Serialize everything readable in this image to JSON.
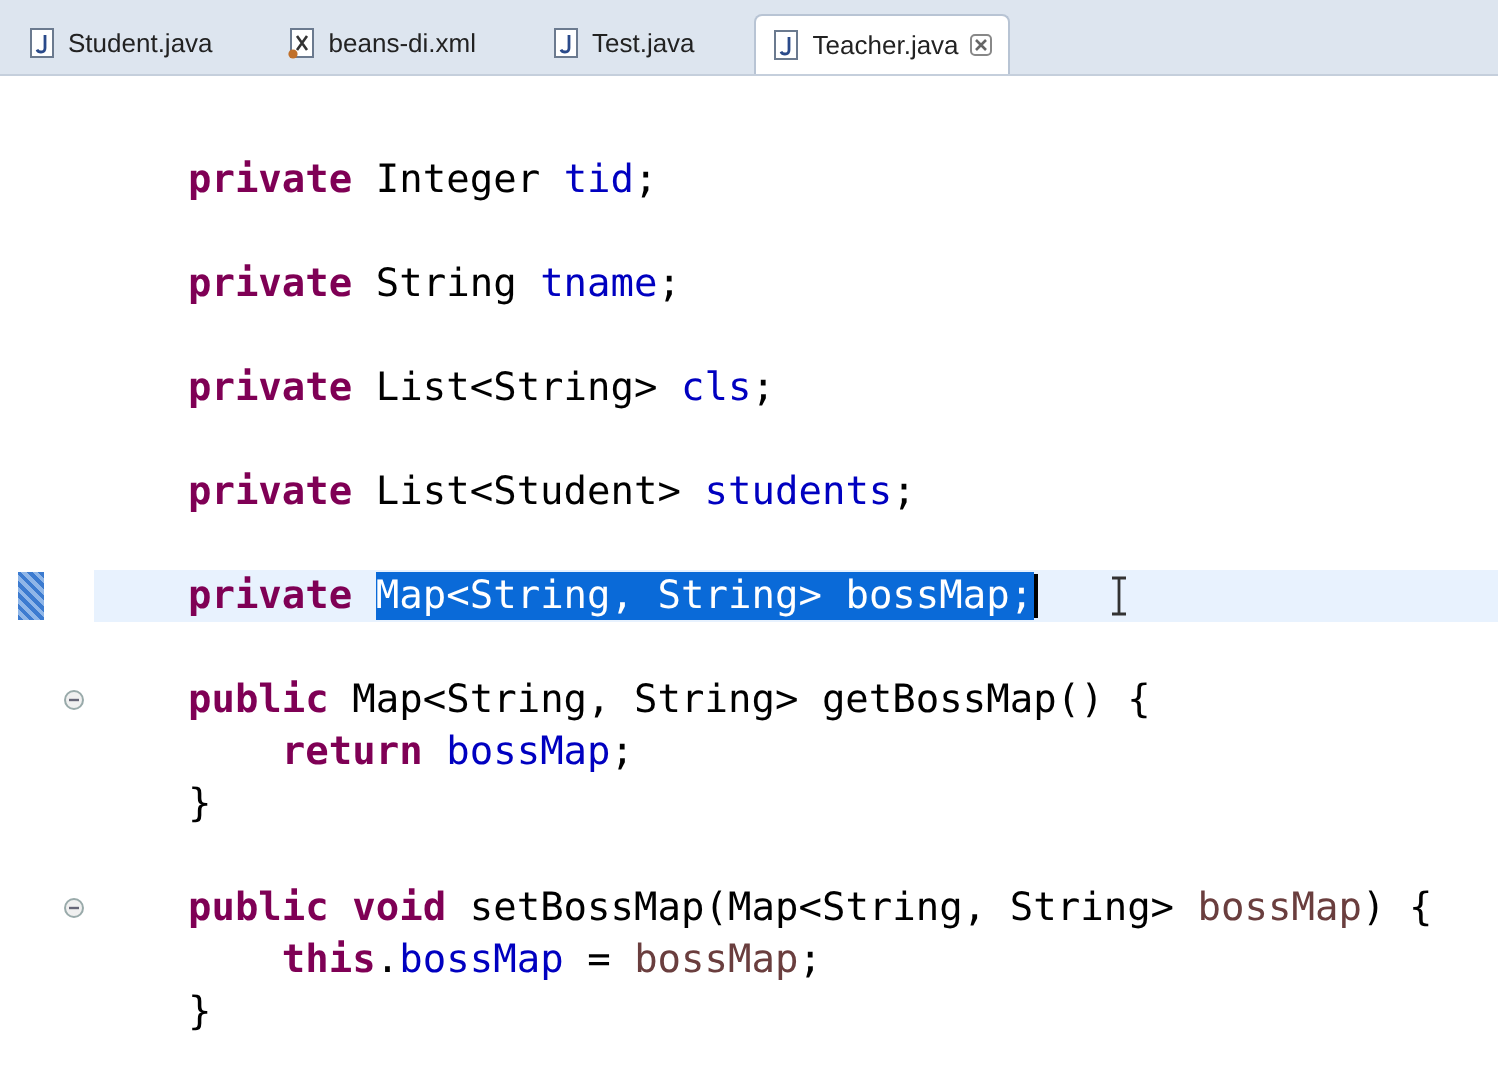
{
  "tabs": [
    {
      "label": "Student.java",
      "kind": "java",
      "selected": false
    },
    {
      "label": "beans-di.xml",
      "kind": "xml",
      "selected": false
    },
    {
      "label": "Test.java",
      "kind": "java",
      "selected": false
    },
    {
      "label": "Teacher.java",
      "kind": "java",
      "selected": true
    }
  ],
  "blocks": [
    {
      "lines": [
        {
          "highlighted": false,
          "foldable": false,
          "tokens": [
            {
              "text": "    private",
              "kind": "keyword",
              "selected": false
            },
            {
              "text": " Integer ",
              "kind": "plain",
              "selected": false
            },
            {
              "text": "tid",
              "kind": "field",
              "selected": false
            },
            {
              "text": ";",
              "kind": "plain",
              "selected": false
            }
          ]
        }
      ]
    },
    {
      "lines": [
        {
          "highlighted": false,
          "foldable": false,
          "tokens": [
            {
              "text": "    private",
              "kind": "keyword",
              "selected": false
            },
            {
              "text": " String ",
              "kind": "plain",
              "selected": false
            },
            {
              "text": "tname",
              "kind": "field",
              "selected": false
            },
            {
              "text": ";",
              "kind": "plain",
              "selected": false
            }
          ]
        }
      ]
    },
    {
      "lines": [
        {
          "highlighted": false,
          "foldable": false,
          "tokens": [
            {
              "text": "    private",
              "kind": "keyword",
              "selected": false
            },
            {
              "text": " List<String> ",
              "kind": "plain",
              "selected": false
            },
            {
              "text": "cls",
              "kind": "field",
              "selected": false
            },
            {
              "text": ";",
              "kind": "plain",
              "selected": false
            }
          ]
        }
      ]
    },
    {
      "lines": [
        {
          "highlighted": false,
          "foldable": false,
          "tokens": [
            {
              "text": "    private",
              "kind": "keyword",
              "selected": false
            },
            {
              "text": " List<Student> ",
              "kind": "plain",
              "selected": false
            },
            {
              "text": "students",
              "kind": "field",
              "selected": false
            },
            {
              "text": ";",
              "kind": "plain",
              "selected": false
            }
          ]
        }
      ]
    },
    {
      "lines": [
        {
          "highlighted": true,
          "foldable": false,
          "tokens": [
            {
              "text": "    private ",
              "kind": "keyword",
              "selected": false
            },
            {
              "text": "Map<String, String> ",
              "kind": "plain",
              "selected": true
            },
            {
              "text": "bossMap",
              "kind": "field",
              "selected": true
            },
            {
              "text": ";",
              "kind": "plain",
              "selected": true
            }
          ]
        }
      ]
    },
    {
      "lines": [
        {
          "highlighted": false,
          "foldable": true,
          "tokens": [
            {
              "text": "    public",
              "kind": "keyword",
              "selected": false
            },
            {
              "text": " Map<String, String> getBossMap() {",
              "kind": "plain",
              "selected": false
            }
          ]
        },
        {
          "highlighted": false,
          "foldable": false,
          "tokens": [
            {
              "text": "        return ",
              "kind": "keyword",
              "selected": false
            },
            {
              "text": "bossMap",
              "kind": "field",
              "selected": false
            },
            {
              "text": ";",
              "kind": "plain",
              "selected": false
            }
          ]
        },
        {
          "highlighted": false,
          "foldable": false,
          "tokens": [
            {
              "text": "    }",
              "kind": "plain",
              "selected": false
            }
          ]
        }
      ]
    },
    {
      "lines": [
        {
          "highlighted": false,
          "foldable": true,
          "tokens": [
            {
              "text": "    public void",
              "kind": "keyword",
              "selected": false
            },
            {
              "text": " setBossMap(Map<String, String> ",
              "kind": "plain",
              "selected": false
            },
            {
              "text": "bossMap",
              "kind": "parameter",
              "selected": false
            },
            {
              "text": ") {",
              "kind": "plain",
              "selected": false
            }
          ]
        },
        {
          "highlighted": false,
          "foldable": false,
          "tokens": [
            {
              "text": "        this",
              "kind": "keyword",
              "selected": false
            },
            {
              "text": ".",
              "kind": "plain",
              "selected": false
            },
            {
              "text": "bossMap",
              "kind": "field",
              "selected": false
            },
            {
              "text": " = ",
              "kind": "plain",
              "selected": false
            },
            {
              "text": "bossMap",
              "kind": "parameter",
              "selected": false
            },
            {
              "text": ";",
              "kind": "plain",
              "selected": false
            }
          ]
        },
        {
          "highlighted": false,
          "foldable": false,
          "tokens": [
            {
              "text": "    }",
              "kind": "plain",
              "selected": false
            }
          ]
        }
      ]
    }
  ]
}
